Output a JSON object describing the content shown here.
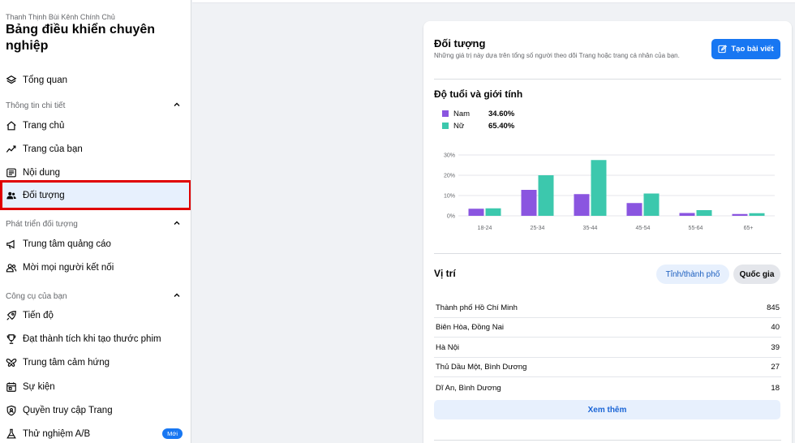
{
  "sidebar": {
    "owner": "Thanh Thịnh Bùi Kênh Chính Chủ",
    "title": "Bảng điều khiển chuyên nghiệp",
    "overview": {
      "label": "Tổng quan",
      "icon": "layers-icon"
    },
    "sections": [
      {
        "heading": "Thông tin chi tiết",
        "items": [
          {
            "label": "Trang chủ",
            "icon": "home-icon"
          },
          {
            "label": "Trang của bạn",
            "icon": "trend-icon"
          },
          {
            "label": "Nội dung",
            "icon": "content-icon"
          },
          {
            "label": "Đối tượng",
            "icon": "audience-icon",
            "active": true
          }
        ]
      },
      {
        "heading": "Phát triển đối tượng",
        "items": [
          {
            "label": "Trung tâm quảng cáo",
            "icon": "megaphone-icon"
          },
          {
            "label": "Mời mọi người kết nối",
            "icon": "invite-people-icon"
          }
        ]
      },
      {
        "heading": "Công cụ của bạn",
        "items": [
          {
            "label": "Tiến độ",
            "icon": "rocket-icon"
          },
          {
            "label": "Đạt thành tích khi tạo thước phim",
            "icon": "trophy-icon"
          },
          {
            "label": "Trung tâm cảm hứng",
            "icon": "butterfly-icon"
          },
          {
            "label": "Sự kiện",
            "icon": "calendar-icon"
          },
          {
            "label": "Quyền truy cập Trang",
            "icon": "shield-icon"
          },
          {
            "label": "Thử nghiệm A/B",
            "icon": "flask-icon",
            "badge": "Mới"
          }
        ]
      }
    ]
  },
  "main": {
    "title": "Đối tượng",
    "description": "Những giá trị này dựa trên tổng số người theo dõi Trang hoặc trang cá nhân của bạn.",
    "create_button": "Tạo bài viết",
    "age_gender": {
      "title": "Độ tuổi và giới tính",
      "legend": [
        {
          "name": "Nam",
          "value": "34.60%",
          "color": "#8a55e0"
        },
        {
          "name": "Nữ",
          "value": "65.40%",
          "color": "#3cc8ad"
        }
      ]
    },
    "location": {
      "title": "Vị trí",
      "tabs": [
        "Tỉnh/thành phố",
        "Quốc gia"
      ],
      "rows": [
        {
          "place": "Thành phố Hồ Chí Minh",
          "count": "845"
        },
        {
          "place": "Biên Hòa, Đồng Nai",
          "count": "40"
        },
        {
          "place": "Hà Nội",
          "count": "39"
        },
        {
          "place": "Thủ Dầu Một, Bình Dương",
          "count": "27"
        },
        {
          "place": "Dĩ An, Bình Dương",
          "count": "18"
        }
      ],
      "see_more": "Xem thêm"
    }
  },
  "chart_data": {
    "type": "bar",
    "categories": [
      "18-24",
      "25-34",
      "35-44",
      "45-54",
      "55-64",
      "65+"
    ],
    "series": [
      {
        "name": "Nam",
        "values": [
          3.5,
          12.8,
          10.7,
          6.3,
          1.4,
          0.9
        ],
        "color": "#8a55e0"
      },
      {
        "name": "Nữ",
        "values": [
          3.7,
          20.0,
          27.5,
          11.0,
          2.8,
          1.3
        ],
        "color": "#3cc8ad"
      }
    ],
    "yticks": [
      "0%",
      "10%",
      "20%",
      "30%"
    ],
    "ylim": [
      0,
      30
    ],
    "grid": true
  }
}
